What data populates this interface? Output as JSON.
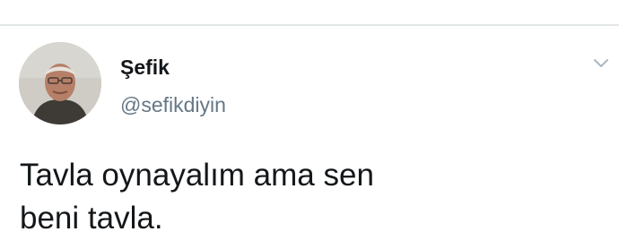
{
  "tweet": {
    "author": {
      "display_name": "Şefik",
      "handle": "@sefikdiyin",
      "avatar_icon": "user-avatar-photo"
    },
    "text": "Tavla oynayalım ama sen\nbeni tavla.",
    "menu_icon": "chevron-down-icon"
  },
  "colors": {
    "background": "#ffffff",
    "divider": "#e3e6e8",
    "primary_text": "#14171a",
    "secondary_text": "#657786",
    "icon": "#aab8c2"
  }
}
